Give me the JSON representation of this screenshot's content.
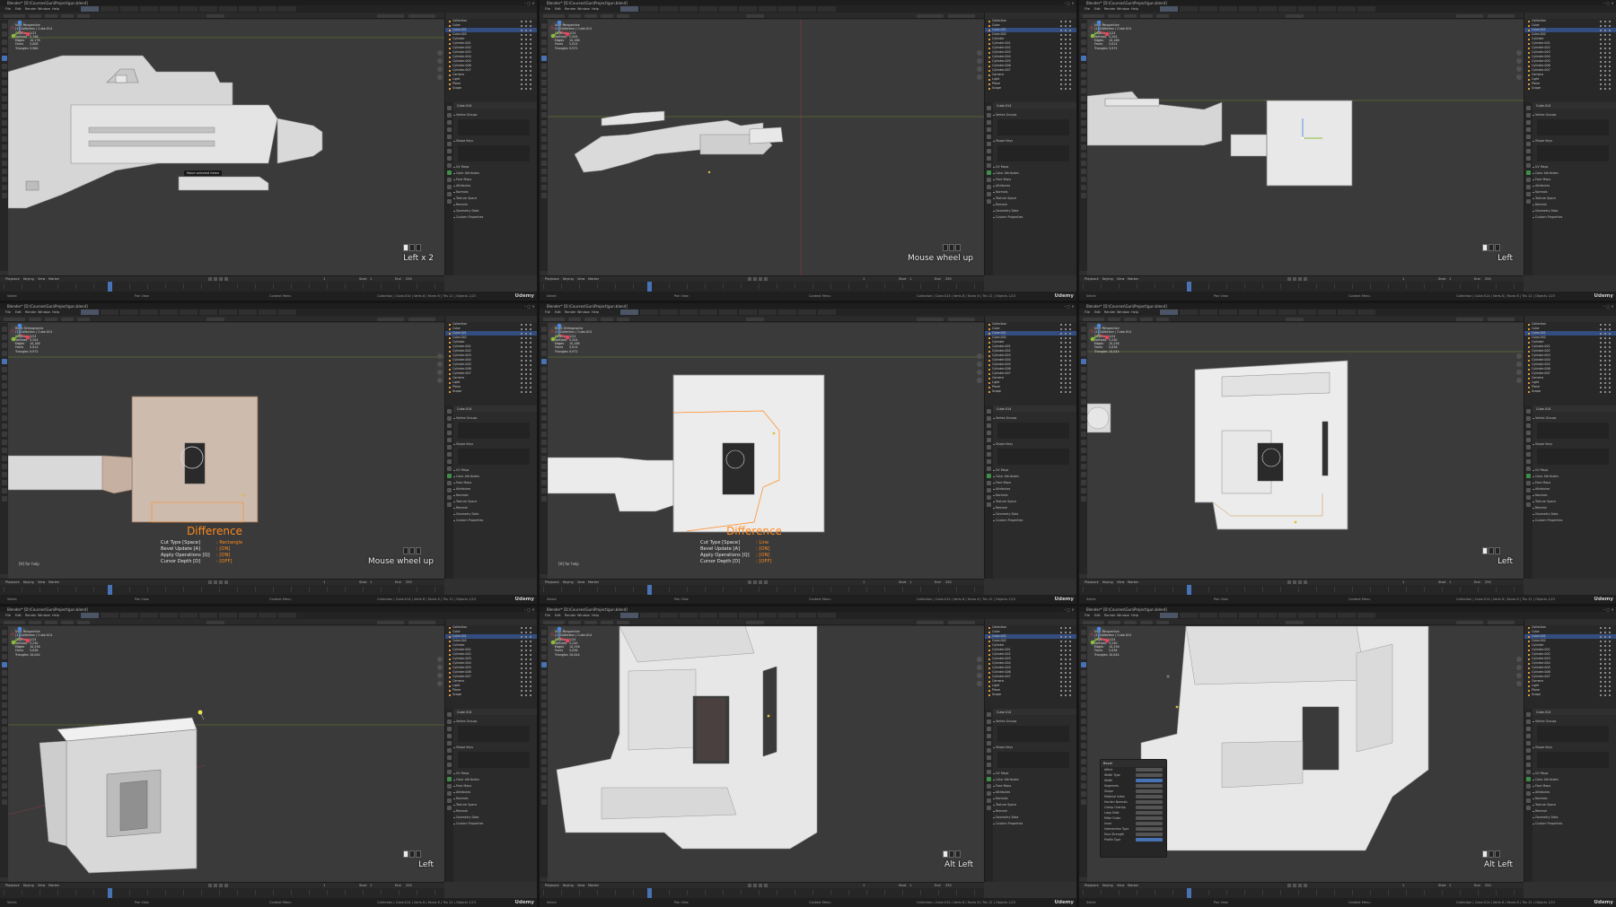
{
  "window_title": "Blender* [D:\\Courses\\Gun\\Project\\gun.blend]",
  "menu": [
    "File",
    "Edit",
    "Render",
    "Window",
    "Help"
  ],
  "workspace_tabs": [
    "Layout",
    "Modeling",
    "Sculpting",
    "UV Editing",
    "Texture Paint",
    "Shading",
    "Animation",
    "Rendering",
    "Compositing",
    "Geometry Nodes",
    "Scripting"
  ],
  "viewport_header": {
    "mode": "Object Mode",
    "view": "View",
    "select": "Select",
    "add": "Add",
    "object": "Object",
    "transform": "Global"
  },
  "outliner": {
    "header": "Scene Collection",
    "rows": [
      "Collection",
      "Cube",
      "Cube.001",
      "Cube.002",
      "Cylinder",
      "Cylinder.001",
      "Cylinder.002",
      "Cylinder.003",
      "Cylinder.004",
      "Cylinder.005",
      "Cylinder.006",
      "Cylinder.007",
      "Camera",
      "Light",
      "Plane",
      "Scope"
    ]
  },
  "properties": {
    "header": "Cube.014",
    "sections": [
      "Vertex Groups",
      "Shape Keys",
      "UV Maps",
      "Color Attributes",
      "Face Maps",
      "Attributes",
      "Normals",
      "Texture Space",
      "Remesh",
      "Geometry Data",
      "Custom Properties"
    ]
  },
  "timeline": {
    "playback": "Playback",
    "keying": "Keying",
    "view": "View",
    "marker": "Marker",
    "start_label": "Start",
    "start": "1",
    "end_label": "End",
    "end": "250",
    "current": "1"
  },
  "status": {
    "left": "Select",
    "middle": "Pan View",
    "right": "Context Menu",
    "stats": "Collection | Cube.014 | Verts 8 | Faces 6 | Tris 12 | Objects 1/23",
    "version": "3.6.2",
    "watermark": "Udemy"
  },
  "panels": [
    {
      "view_name": "User Perspective",
      "collection": "(1) Collection | Cube.014",
      "stats": {
        "objects": "1/23",
        "vertices": "5,196",
        "edges": "10,176",
        "faces": "5,008",
        "triangles": "9,960"
      },
      "keycast": "Left x 2",
      "tooltip": "Move selected items"
    },
    {
      "view_name": "User Perspective",
      "collection": "(1) Collection | Cube.014",
      "stats": {
        "objects": "1/24",
        "vertices": "5,204",
        "edges": "10,188",
        "faces": "5,014",
        "triangles": "9,972"
      },
      "keycast": "Mouse wheel up"
    },
    {
      "view_name": "User Perspective",
      "collection": "(1) Collection | Cube.014",
      "stats": {
        "objects": "1/24",
        "vertices": "5,204",
        "edges": "10,188",
        "faces": "5,014",
        "triangles": "9,972"
      },
      "keycast": "Left"
    },
    {
      "view_name": "Right Orthographic",
      "collection": "(1) Collection | Cube.014",
      "stats": {
        "objects": "1/24",
        "vertices": "5,204",
        "edges": "10,188",
        "faces": "5,014",
        "triangles": "9,972"
      },
      "keycast": "Mouse wheel up",
      "help": "[H] for help",
      "boxcut": {
        "mode": "Difference",
        "rows": [
          {
            "k": "Cut Type [Space]",
            "v": ": Rectangle"
          },
          {
            "k": "Bevel Update [A]",
            "v": ": [ON]"
          },
          {
            "k": "Apply Operations [Q]",
            "v": ": [ON]"
          },
          {
            "k": "Cursor Depth [D]",
            "v": ": [OFF]"
          }
        ]
      }
    },
    {
      "view_name": "Right Orthographic",
      "collection": "(1) Collection | Cube.014",
      "stats": {
        "objects": "1/24",
        "vertices": "5,204",
        "edges": "10,188",
        "faces": "5,014",
        "triangles": "9,972"
      },
      "keycast": "",
      "help": "[H] for help",
      "boxcut": {
        "mode": "Difference",
        "rows": [
          {
            "k": "Cut Type [Space]",
            "v": ": Line"
          },
          {
            "k": "Bevel Update [A]",
            "v": ": [ON]"
          },
          {
            "k": "Apply Operations [Q]",
            "v": ": [ON]"
          },
          {
            "k": "Cursor Depth [D]",
            "v": ": [OFF]"
          }
        ]
      }
    },
    {
      "view_name": "User Perspective",
      "collection": "(1) Collection | Cube.014",
      "stats": {
        "objects": "1/24",
        "vertices": "5,240",
        "edges": "10,256",
        "faces": "5,036",
        "triangles": "10,044"
      },
      "keycast": "Left"
    },
    {
      "view_name": "User Perspective",
      "collection": "(1) Collection | Cube.014",
      "stats": {
        "objects": "1/24",
        "vertices": "5,240",
        "edges": "10,256",
        "faces": "5,036",
        "triangles": "10,044"
      },
      "keycast": "Left"
    },
    {
      "view_name": "User Perspective",
      "collection": "(1) Collection | Cube.014",
      "stats": {
        "objects": "1/24",
        "vertices": "5,240",
        "edges": "10,256",
        "faces": "5,036",
        "triangles": "10,044"
      },
      "keycast": "Alt Left"
    },
    {
      "view_name": "User Perspective",
      "collection": "(1) Collection | Cube.014",
      "stats": {
        "objects": "1/24",
        "vertices": "5,240",
        "edges": "10,256",
        "faces": "5,036",
        "triangles": "10,044"
      },
      "keycast": "Alt Left",
      "redo_panel": {
        "title": "Bevel",
        "rows": [
          "Affect",
          "Width Type",
          "Width",
          "Segments",
          "Shape",
          "Material Index",
          "Harden Normals",
          "Clamp Overlap",
          "Loop Slide",
          "Miter Outer",
          "Inner",
          "Intersection Type",
          "Face Strength",
          "Profile Type"
        ]
      }
    }
  ],
  "labels": {
    "objects": "Objects",
    "vertices": "Vertices",
    "edges": "Edges",
    "faces": "Faces",
    "triangles": "Triangles"
  },
  "colors": {
    "accent": "#4772b3",
    "selected_outline": "#ff8a1f",
    "background": "#3a3a3a"
  }
}
